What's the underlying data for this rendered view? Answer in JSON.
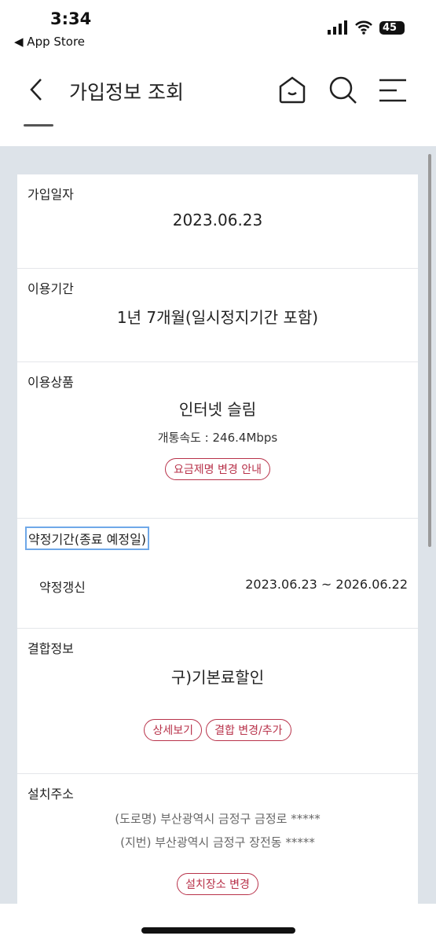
{
  "status": {
    "time": "3:34",
    "back_app": "◀ App Store",
    "battery": "45"
  },
  "header": {
    "title": "가입정보 조회"
  },
  "sections": {
    "join_date": {
      "label": "가입일자",
      "value": "2023.06.23"
    },
    "usage_period": {
      "label": "이용기간",
      "value": "1년 7개월(일시정지기간 포함)"
    },
    "product": {
      "label": "이용상품",
      "value": "인터넷 슬림",
      "speed": "개통속도 : 246.4Mbps",
      "button": "요금제명 변경 안내"
    },
    "contract": {
      "label": "약정기간(종료 예정일)",
      "type": "약정갱신",
      "period": "2023.06.23 ~ 2026.06.22"
    },
    "bundle": {
      "label": "결합정보",
      "value": "구)기본료할인",
      "buttons": [
        "상세보기",
        "결합 변경/추가"
      ]
    },
    "address": {
      "label": "설치주소",
      "road": "(도로명) 부산광역시 금정구 금정로 *****",
      "lot": "(지번) 부산광역시 금정구 장전동 *****",
      "button": "설치장소 변경"
    }
  },
  "colors": {
    "accent": "#b8324a",
    "background": "#dde3e9"
  }
}
